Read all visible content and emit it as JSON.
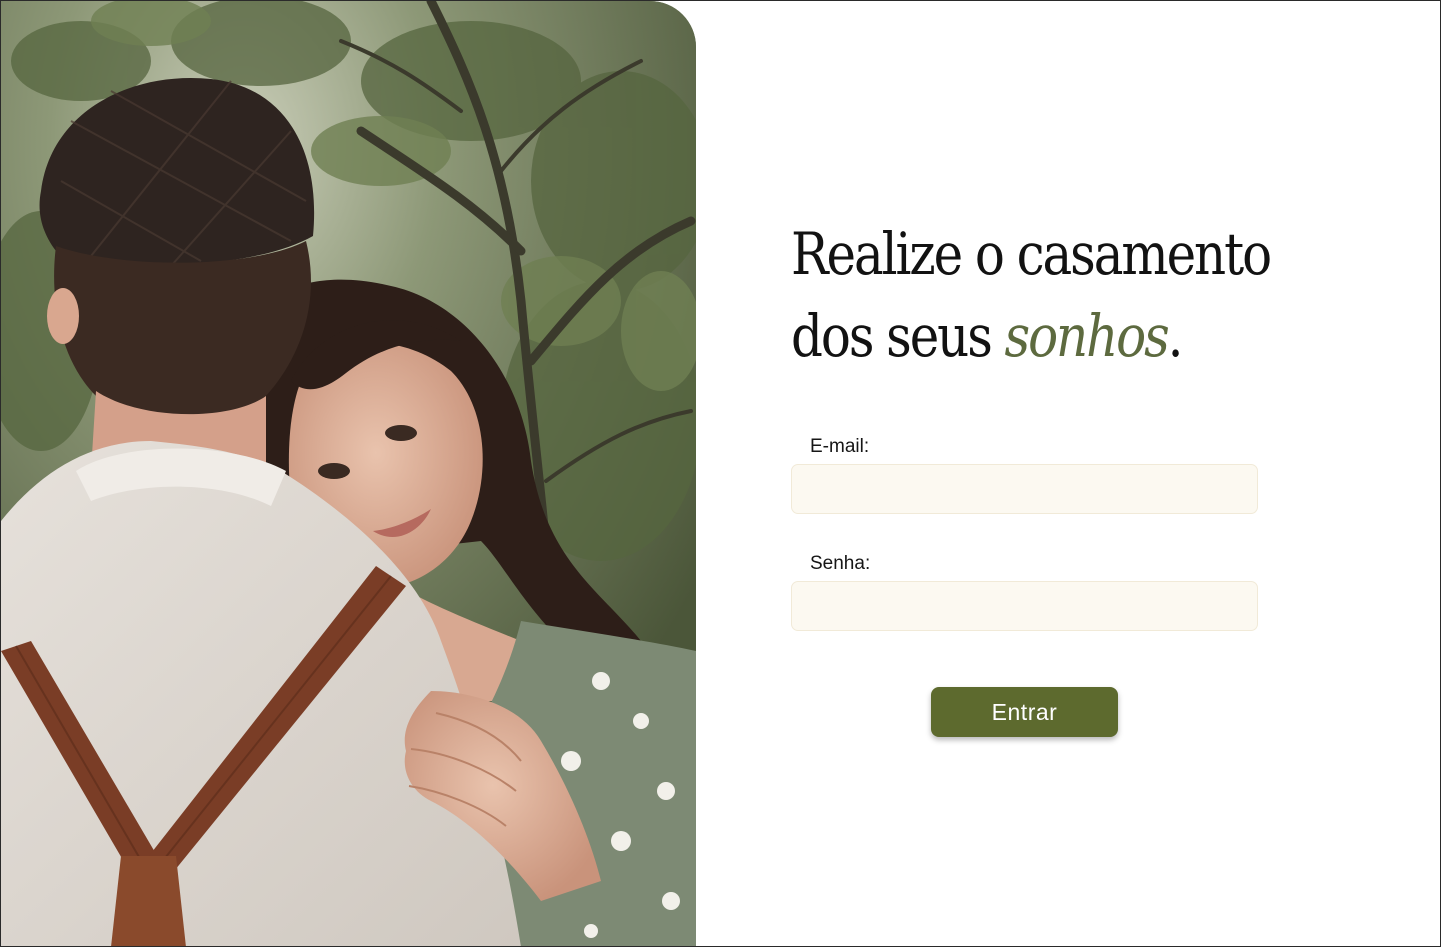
{
  "hero": {
    "image_alt": "couple-embrace-photo"
  },
  "headline": {
    "line1": "Realize o casamento",
    "line2_prefix": "dos seus ",
    "line2_accent": "sonhos",
    "line2_suffix": "."
  },
  "form": {
    "email_label": "E-mail:",
    "email_value": "",
    "password_label": "Senha:",
    "password_value": "",
    "submit_label": "Entrar"
  },
  "colors": {
    "accent": "#5d6a3f",
    "button": "#5d6a2e",
    "input_bg": "#fcf9f1"
  }
}
